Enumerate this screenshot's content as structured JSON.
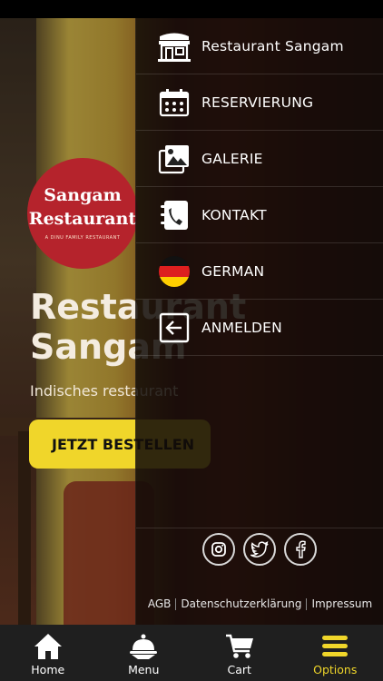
{
  "hero": {
    "logo_line1": "Sangam",
    "logo_line2": "Restaurant",
    "logo_tagline": "A DINU FAMILY RESTAURANT",
    "title_line1": "Restaurant",
    "title_line2": "Sangam",
    "subtitle": "Indisches restaurant",
    "cta_label": "JETZT BESTELLEN"
  },
  "drawer": {
    "items": [
      {
        "label": "Restaurant Sangam",
        "icon": "restaurant-building-icon"
      },
      {
        "label": "RESERVIERUNG",
        "icon": "calendar-icon"
      },
      {
        "label": "GALERIE",
        "icon": "gallery-icon"
      },
      {
        "label": "KONTAKT",
        "icon": "contact-phone-icon"
      },
      {
        "label": "GERMAN",
        "icon": "german-flag-icon"
      },
      {
        "label": "ANMELDEN",
        "icon": "login-arrow-icon"
      }
    ],
    "social": [
      "instagram-icon",
      "twitter-icon",
      "facebook-icon"
    ],
    "footer_links": [
      "AGB",
      "Datenschutzerklärung",
      "Impressum"
    ]
  },
  "tabbar": {
    "tabs": [
      {
        "label": "Home",
        "icon": "home-icon"
      },
      {
        "label": "Menu",
        "icon": "menu-cloche-icon"
      },
      {
        "label": "Cart",
        "icon": "cart-icon"
      },
      {
        "label": "Options",
        "icon": "hamburger-icon"
      }
    ],
    "active_tab": "Options",
    "accent_color": "#f0d62a"
  },
  "colors": {
    "accent": "#f0d62a",
    "logo_red": "#b5232c",
    "drawer_bg": "#120c08",
    "tabbar_bg": "#1f1f1f"
  }
}
